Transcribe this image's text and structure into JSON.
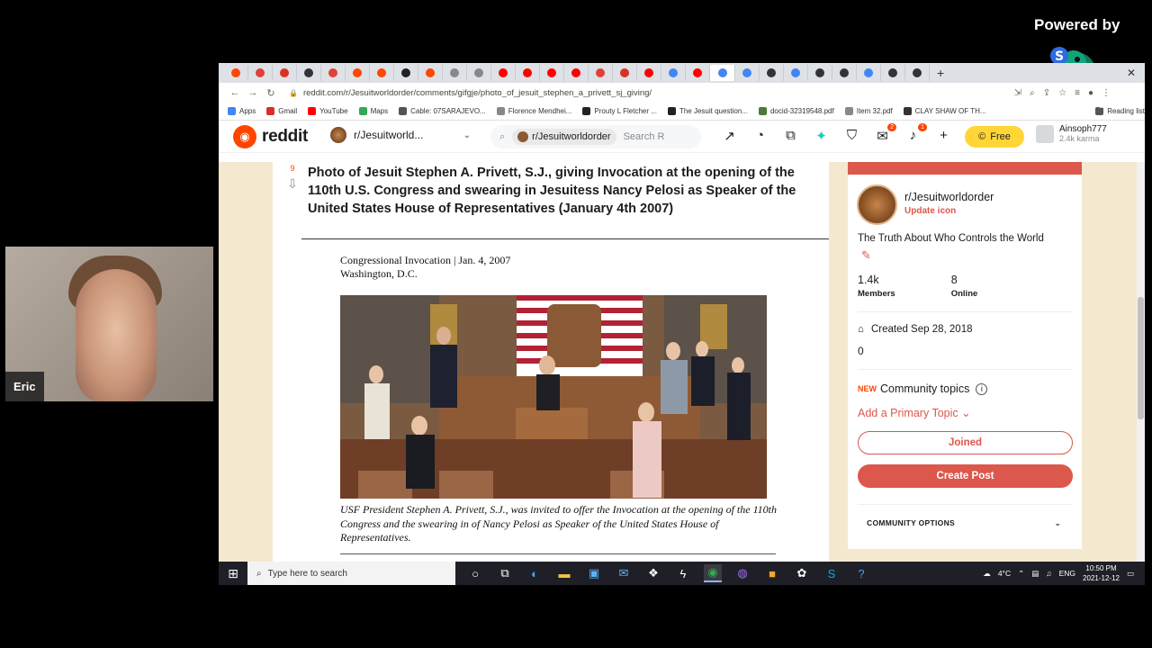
{
  "overlay": {
    "powered_by": "Powered by",
    "watermark": "StreamYard",
    "participant_name": "Eric"
  },
  "browser": {
    "url": "reddit.com/r/Jesuitworldorder/comments/gifgje/photo_of_jesuit_stephen_a_privett_sj_giving/",
    "tabs": [
      {
        "color": "#ff4500"
      },
      {
        "color": "#e0403a"
      },
      {
        "color": "#d93025"
      },
      {
        "color": "#333333"
      },
      {
        "color": "#e0403a"
      },
      {
        "color": "#ff4500"
      },
      {
        "color": "#ff4500"
      },
      {
        "color": "#222222"
      },
      {
        "color": "#ff4500"
      },
      {
        "color": "#888888"
      },
      {
        "color": "#888888"
      },
      {
        "color": "#ff0000"
      },
      {
        "color": "#ff0000"
      },
      {
        "color": "#ff0000"
      },
      {
        "color": "#ff0000"
      },
      {
        "color": "#e0403a"
      },
      {
        "color": "#d93025"
      },
      {
        "color": "#ff0000"
      },
      {
        "color": "#4285f4"
      },
      {
        "color": "#ff0000"
      },
      {
        "color": "#4285f4"
      },
      {
        "color": "#4285f4"
      },
      {
        "color": "#333333"
      },
      {
        "color": "#4285f4"
      },
      {
        "color": "#333333"
      },
      {
        "color": "#333333"
      },
      {
        "color": "#4285f4"
      },
      {
        "color": "#333333"
      },
      {
        "color": "#333333"
      }
    ],
    "bookmarks": [
      {
        "label": "Apps",
        "color": "#4285f4"
      },
      {
        "label": "Gmail",
        "color": "#d93025"
      },
      {
        "label": "YouTube",
        "color": "#ff0000"
      },
      {
        "label": "Maps",
        "color": "#34a853"
      },
      {
        "label": "Cable: 07SARAJEVO...",
        "color": "#555555"
      },
      {
        "label": "Florence Mendhei...",
        "color": "#888888"
      },
      {
        "label": "Prouty L Fletcher ...",
        "color": "#222222"
      },
      {
        "label": "The Jesuit question...",
        "color": "#222222"
      },
      {
        "label": "docid-32319548.pdf",
        "color": "#4a7a3a"
      },
      {
        "label": "Item 32.pdf",
        "color": "#888888"
      },
      {
        "label": "CLAY SHAW OF TH...",
        "color": "#333333"
      },
      {
        "label": "Reading list",
        "color": "#555555"
      }
    ]
  },
  "reddit": {
    "wordmark": "reddit",
    "subreddit": "r/Jesuitworld...",
    "search_scope": "r/Jesuitworldorder",
    "search_placeholder": "Search R",
    "free_label": "Free",
    "badge_chat": "2",
    "badge_notif": "1",
    "username": "Ainsoph777",
    "karma": "2.4k karma"
  },
  "post": {
    "score": "9",
    "title": "Photo of Jesuit Stephen A. Privett, S.J., giving Invocation at the opening of the 110th U.S. Congress and swearing in Jesuitess Nancy Pelosi as Speaker of the United States House of Representatives (January 4th 2007)",
    "doc_line1": "Congressional Invocation | Jan. 4, 2007",
    "doc_line2": "Washington, D.C.",
    "caption": "USF President Stephen A. Privett, S.J., was invited to offer the Invocation at the opening of the 110th Congress and the swearing in of Nancy Pelosi as Speaker of the United States House of Representatives."
  },
  "sidebar": {
    "name": "r/Jesuitworldorder",
    "update_icon": "Update icon",
    "description": "The Truth About Who Controls the World",
    "members_count": "1.4k",
    "members_label": "Members",
    "online_count": "8",
    "online_label": "Online",
    "created": "Created Sep 28, 2018",
    "zero": "0",
    "new_tag": "NEW",
    "community_topics": "Community topics",
    "add_topic": "Add a Primary Topic",
    "joined_label": "Joined",
    "create_post_label": "Create Post",
    "community_options": "COMMUNITY OPTIONS",
    "accent": "#dc574c"
  },
  "taskbar": {
    "search_placeholder": "Type here to search",
    "temperature": "4°C",
    "language": "ENG",
    "time": "10:50 PM",
    "date": "2021-12-12"
  }
}
